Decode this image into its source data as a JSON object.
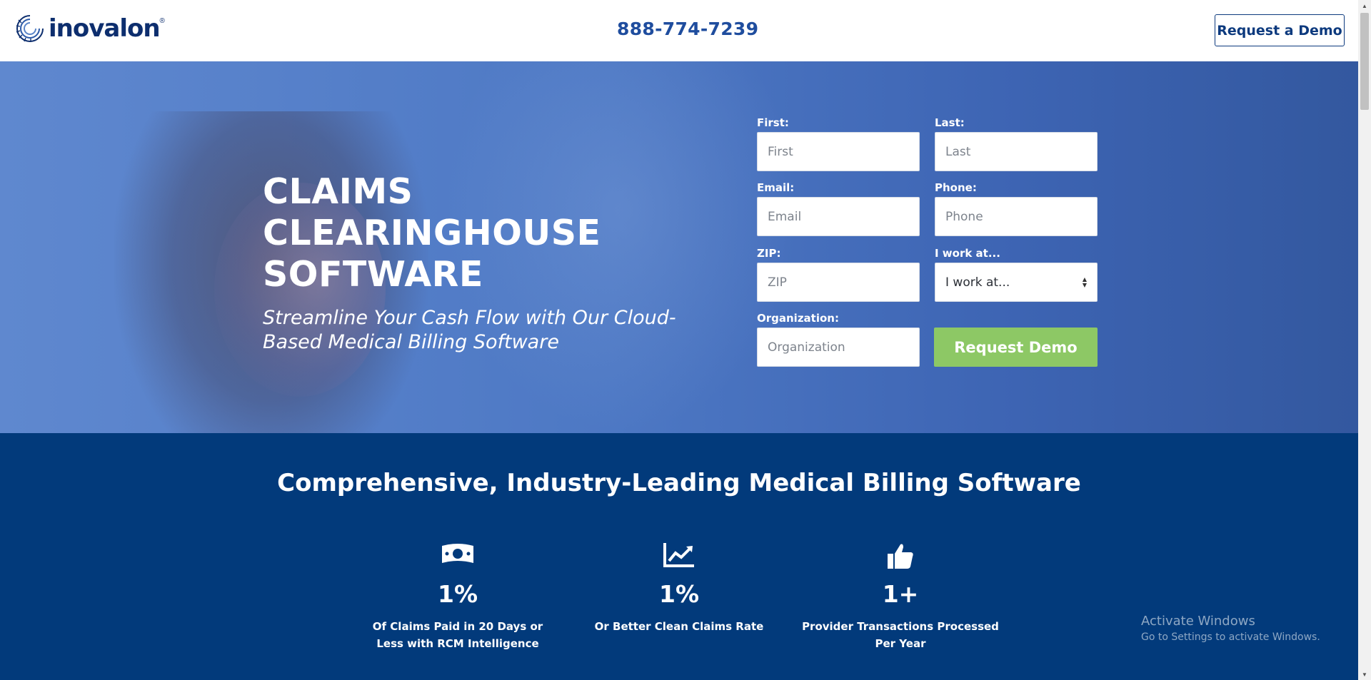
{
  "header": {
    "logo_text": "inovalon",
    "logo_reg": "®",
    "phone": "888-774-7239",
    "demo_button": "Request a Demo"
  },
  "hero": {
    "title": "CLAIMS CLEARINGHOUSE SOFTWARE",
    "subtitle": "Streamline Your Cash Flow with Our Cloud-Based Medical Billing Software"
  },
  "form": {
    "first_label": "First:",
    "first_placeholder": "First",
    "last_label": "Last:",
    "last_placeholder": "Last",
    "email_label": "Email:",
    "email_placeholder": "Email",
    "phone_label": "Phone:",
    "phone_placeholder": "Phone",
    "zip_label": "ZIP:",
    "zip_placeholder": "ZIP",
    "work_label": "I work at...",
    "work_selected": "I work at...",
    "org_label": "Organization:",
    "org_placeholder": "Organization",
    "submit": "Request Demo"
  },
  "stats": {
    "title": "Comprehensive, Industry-Leading Medical Billing Software",
    "items": [
      {
        "icon": "money-bill-icon",
        "value": "1%",
        "label": "Of Claims Paid in 20 Days or Less with RCM Intelligence"
      },
      {
        "icon": "chart-line-icon",
        "value": "1%",
        "label": "Or Better Clean Claims Rate"
      },
      {
        "icon": "thumbs-up-icon",
        "value": "1+",
        "label": "Provider Transactions Processed Per Year"
      }
    ]
  },
  "watermark": {
    "line1": "Activate Windows",
    "line2": "Go to Settings to activate Windows."
  },
  "colors": {
    "brand_navy": "#0d2e6e",
    "phone_blue": "#1f4d9e",
    "stats_bg": "#023a7b",
    "submit_green": "#8dc865"
  }
}
